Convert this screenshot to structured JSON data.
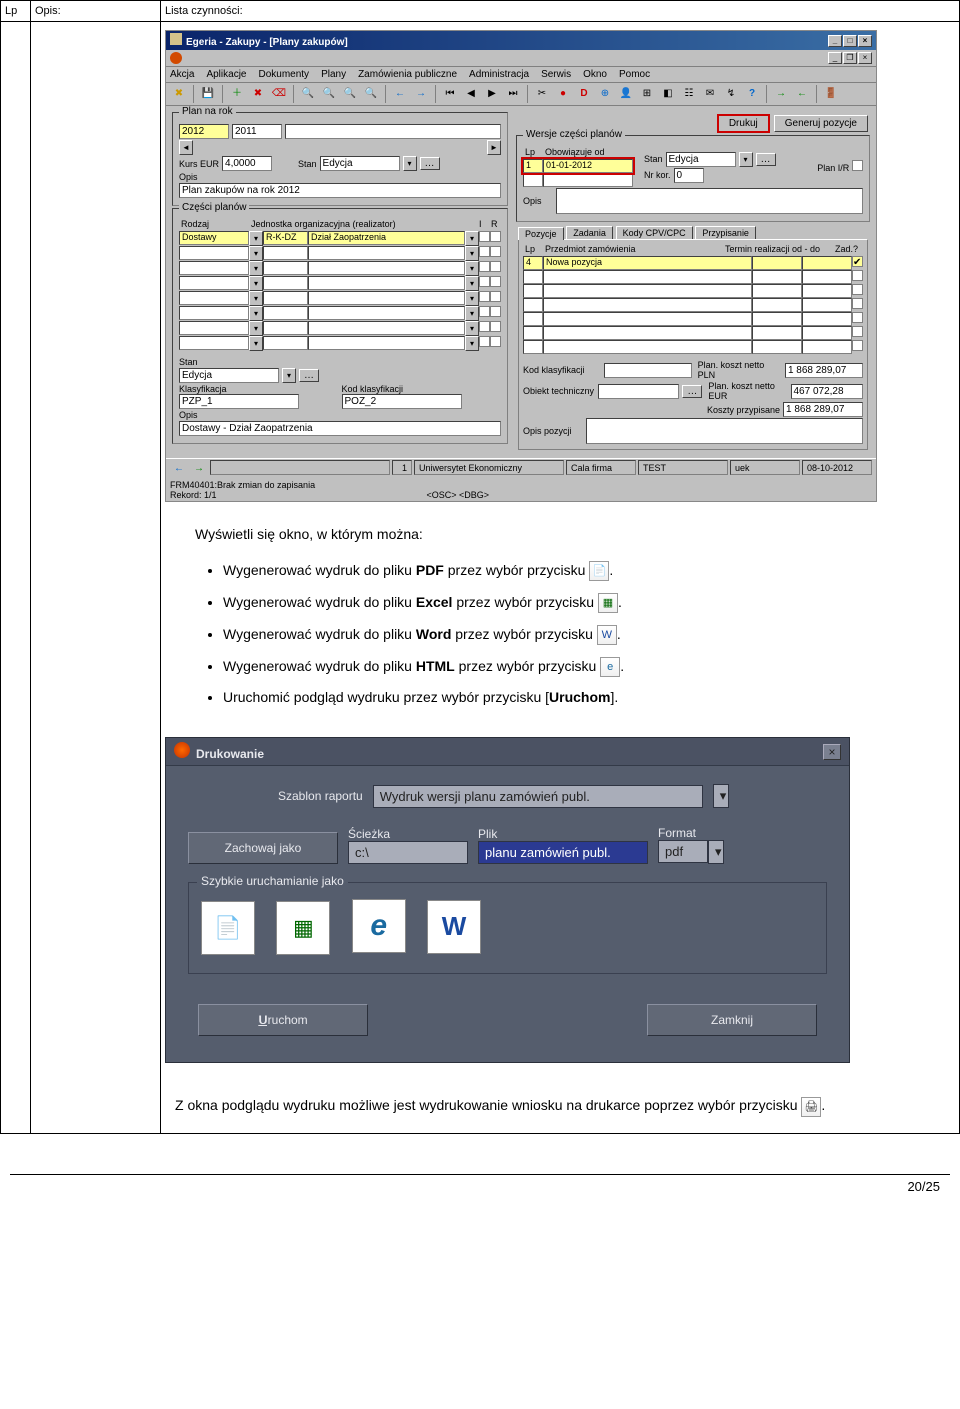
{
  "header": {
    "lp": "Lp",
    "opis": "Opis:",
    "lista": "Lista czynności:"
  },
  "app": {
    "title": "Egeria - Zakupy - [Plany zakupów]",
    "menus": [
      "Akcja",
      "Aplikacje",
      "Dokumenty",
      "Plany",
      "Zamówienia publiczne",
      "Administracja",
      "Serwis",
      "Okno",
      "Pomoc"
    ],
    "plan_na_rok": {
      "legend": "Plan na rok",
      "rok1": "2012",
      "rok2": "2011",
      "kurs_lbl": "Kurs EUR",
      "kurs_val": "4,0000",
      "stan_lbl": "Stan",
      "stan_val": "Edycja",
      "opis_lbl": "Opis",
      "opis_val": "Plan zakupów na rok 2012"
    },
    "czesci": {
      "legend": "Części planów",
      "col_rodzaj": "Rodzaj",
      "col_jednostka": "Jednostka organizacyjna (realizator)",
      "col_i": "I",
      "col_r": "R",
      "row1_rodzaj": "Dostawy",
      "row1_jedn": "R-K-DZ",
      "row1_jedn2": "Dział Zaopatrzenia",
      "stan_lbl": "Stan",
      "stan_val": "Edycja",
      "klas_lbl": "Klasyfikacja",
      "klas_val": "PZP_1",
      "kod_lbl": "Kod klasyfikacji",
      "kod_val": "POZ_2",
      "opis_lbl": "Opis",
      "opis_val": "Dostawy - Dział Zaopatrzenia"
    },
    "top_buttons": {
      "drukuj": "Drukuj",
      "generuj": "Generuj pozycje"
    },
    "wersje": {
      "legend": "Wersje części planów",
      "col_lp": "Lp",
      "col_obow": "Obowiązuje od",
      "row_lp": "1",
      "row_obow": "01-01-2012",
      "stan_lbl": "Stan",
      "stan_val": "Edycja",
      "nrkor_lbl": "Nr kor.",
      "nrkor_val": "0",
      "plan_ir_lbl": "Plan I/R",
      "opis_lbl": "Opis"
    },
    "pozycje": {
      "tabs": [
        "Pozycje",
        "Zadania",
        "Kody CPV/CPC",
        "Przypisanie"
      ],
      "col_lp": "Lp",
      "col_przedmiot": "Przedmiot zamówienia",
      "col_termin": "Termin realizacji od - do",
      "col_zad": "Zad.?",
      "row_lp": "4",
      "row_przedmiot": "Nowa pozycja",
      "kod_klas_lbl": "Kod klasyfikacji",
      "obiekt_lbl": "Obiekt techniczny",
      "plan_pln_lbl": "Plan. koszt netto PLN",
      "plan_pln_val": "1 868 289,07",
      "plan_eur_lbl": "Plan. koszt netto EUR",
      "plan_eur_val": "467 072,28",
      "koszty_lbl": "Koszty przypisane",
      "koszty_val": "1 868 289,07",
      "opis_lbl": "Opis pozycji"
    },
    "status": {
      "s1": "1",
      "s2": "Uniwersytet Ekonomiczny",
      "s3": "Cala firma",
      "s4": "TEST",
      "s5": "uek",
      "s6": "08-10-2012"
    },
    "msg": {
      "m1": "FRM40401:Brak zmian do zapisania",
      "m2": "Rekord: 1/1",
      "m3": "<OSC> <DBG>"
    }
  },
  "bullets": {
    "intro": "Wyświetli się okno, w którym można:",
    "b1a": "Wygenerować wydruk do pliku ",
    "b1b": "PDF",
    "b1c": " przez wybór przycisku ",
    "b2a": "Wygenerować wydruk do pliku ",
    "b2b": "Excel",
    "b2c": " przez wybór przycisku ",
    "b3a": "Wygenerować wydruk do pliku ",
    "b3b": "Word",
    "b3c": " przez wybór przycisku ",
    "b4a": "Wygenerować wydruk do pliku ",
    "b4b": "HTML",
    "b4c": " przez wybór przycisku ",
    "b5a": "Uruchomić podgląd wydruku przez wybór przycisku [",
    "b5b": "Uruchom",
    "b5c": "]."
  },
  "dialog": {
    "title": "Drukowanie",
    "szablon_lbl": "Szablon raportu",
    "szablon_val": "Wydruk wersji planu zamówień publ.",
    "zachowaj": "Zachowaj jako",
    "sciezka_lbl": "Ścieżka",
    "sciezka_val": "c:\\",
    "plik_lbl": "Plik",
    "plik_val": "planu zamówień publ.",
    "format_lbl": "Format",
    "format_val": "pdf",
    "group_legend": "Szybkie uruchamianie jako",
    "uruchom": "Uruchom",
    "zamknij": "Zamknij"
  },
  "footer": {
    "text1": "Z okna podglądu wydruku możliwe jest wydrukowanie wniosku na drukarce poprzez wybór przycisku ",
    "text2": "."
  },
  "pageno": "20/25"
}
